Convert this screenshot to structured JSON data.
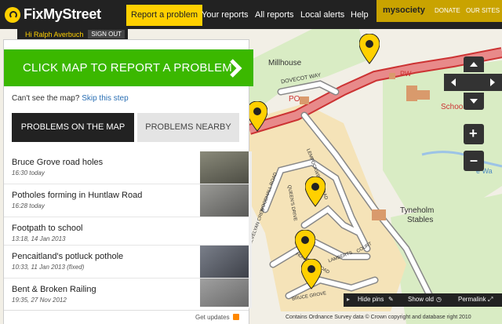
{
  "header": {
    "logo": "FixMyStreet",
    "nav": [
      "Report a problem",
      "Your reports",
      "All reports",
      "Local alerts",
      "Help"
    ],
    "mysociety": {
      "logo": "mysociety",
      "donate": "DONATE",
      "our_sites": "OUR SITES"
    }
  },
  "user": {
    "greeting": "Hi Ralph Averbuch",
    "signout": "SIGN OUT"
  },
  "sidebar": {
    "cta": "CLICK MAP TO REPORT A PROBLEM",
    "cant_see": "Can't see the map?",
    "skip": "Skip this step",
    "tabs": [
      "PROBLEMS ON THE MAP",
      "PROBLEMS NEARBY"
    ],
    "problems": [
      {
        "title": "Bruce Grove road holes",
        "date": "16:30 today"
      },
      {
        "title": "Potholes forming in Huntlaw Road",
        "date": "16:28 today"
      },
      {
        "title": "Footpath to school",
        "date": "13:18, 14 Jan 2013"
      },
      {
        "title": "Pencaitland's potluck pothole",
        "date": "10:33, 11 Jan 2013 (fixed)"
      },
      {
        "title": "Bent & Broken Railing",
        "date": "19:35, 27 Nov 2012"
      }
    ],
    "get_updates": "Get updates"
  },
  "map": {
    "labels": {
      "millhouse": "Millhouse",
      "dovecot": "DOVECOT WAY",
      "po": "PO",
      "pw": "PW",
      "school": "School",
      "tyneholm": "Tyneholm",
      "stables": "Stables",
      "lempockwells": "LEMPOCKWELLS ROAD",
      "huntlaw": "HUNTLAW ROAD",
      "lamberts": "LAMBERTS",
      "court": "COURT",
      "bruce": "BRUCE GROVE",
      "queens": "QUEEN'S DRIVE",
      "trevelyan": "TREVELYAN CRES",
      "woodhall": "WOODHALL ROAD",
      "tyne_wa": "e Wa"
    },
    "controls": {
      "zoom_in": "+",
      "zoom_out": "–"
    },
    "bottom": {
      "hide_pins": "Hide pins",
      "show_old": "Show old",
      "permalink": "Permalink"
    },
    "copyright": "Contains Ordnance Survey data © Crown copyright and database right 2010"
  },
  "colors": {
    "brand_yellow": "#ffd000",
    "cta_green": "#3bb800",
    "dark": "#222222",
    "link": "#2a6fb4"
  }
}
